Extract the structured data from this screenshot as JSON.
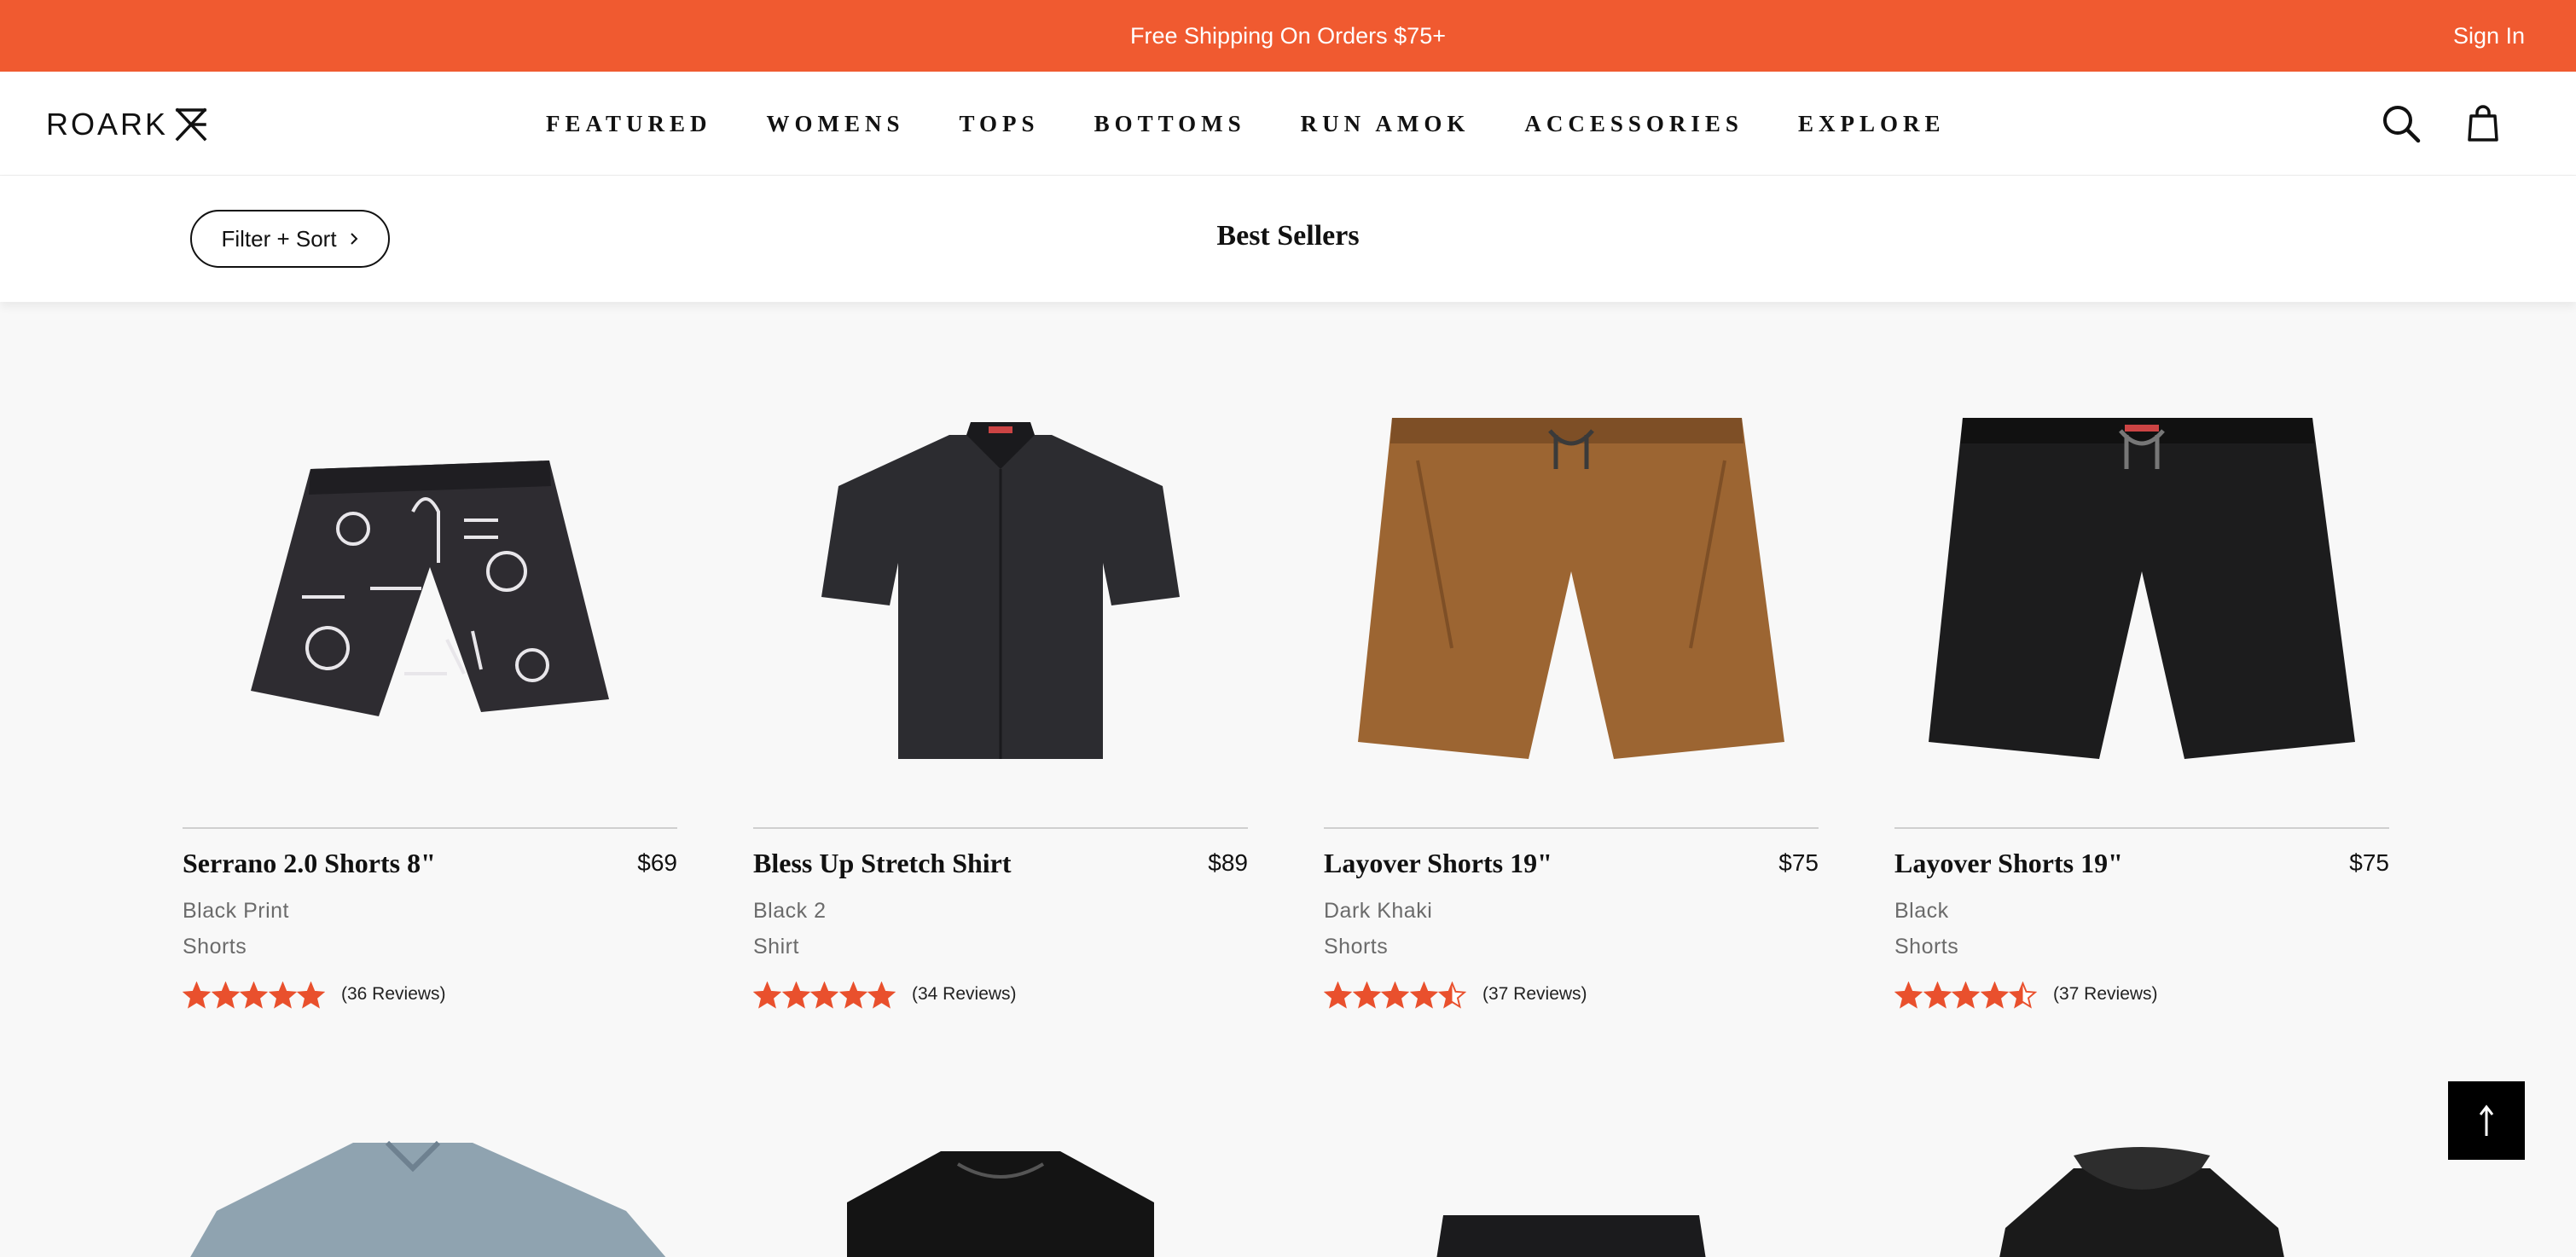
{
  "promo": {
    "text": "Free Shipping On Orders $75+",
    "signin": "Sign In"
  },
  "brand": {
    "logo_text": "ROARK"
  },
  "nav": [
    "FEATURED",
    "WOMENS",
    "TOPS",
    "BOTTOMS",
    "RUN AMOK",
    "ACCESSORIES",
    "EXPLORE"
  ],
  "header_icons": [
    "search-icon",
    "cart-bag-icon"
  ],
  "filter": {
    "label": "Filter + Sort"
  },
  "page": {
    "title": "Best Sellers"
  },
  "products": [
    {
      "name": "Serrano 2.0 Shorts 8\"",
      "price": "$69",
      "color": "Black Print",
      "type": "Shorts",
      "rating": 5,
      "reviews": "(36 Reviews)"
    },
    {
      "name": "Bless Up Stretch Shirt",
      "price": "$89",
      "color": "Black 2",
      "type": "Shirt",
      "rating": 5,
      "reviews": "(34 Reviews)"
    },
    {
      "name": "Layover Shorts 19\"",
      "price": "$75",
      "color": "Dark Khaki",
      "type": "Shorts",
      "rating": 4.5,
      "reviews": "(37 Reviews)"
    },
    {
      "name": "Layover Shorts 19\"",
      "price": "$75",
      "color": "Black",
      "type": "Shorts",
      "rating": 4.5,
      "reviews": "(37 Reviews)"
    }
  ],
  "colors": {
    "accent": "#f05a30",
    "star": "#e9502d",
    "text": "#111111",
    "muted": "#6b6b6b",
    "background": "#f8f8f8"
  },
  "back_to_top_icon": "arrow-up-icon"
}
